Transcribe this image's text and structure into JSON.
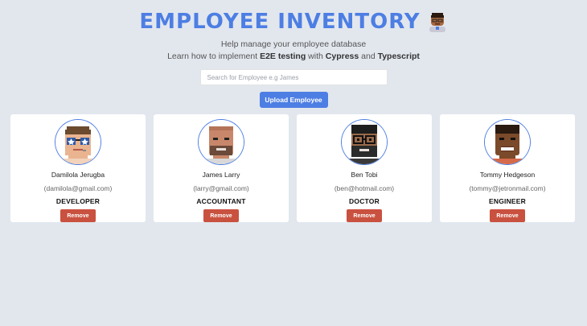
{
  "header": {
    "title": "EMPLOYEE INVENTORY",
    "title_icon": "man-technologist-emoji-icon",
    "subtitle": "Help manage your employee database",
    "tagline": {
      "prefix": "Learn how to implement ",
      "e2e": "E2E testing",
      "with": " with ",
      "cypress": "Cypress",
      "and": " and ",
      "typescript": "Typescript"
    }
  },
  "search": {
    "placeholder": "Search for Employee e.g James",
    "value": ""
  },
  "upload_button": {
    "label": "Upload Employee"
  },
  "colors": {
    "accent": "#4d7ee3",
    "remove": "#c9513f",
    "background": "#e2e7ee"
  },
  "employees": [
    {
      "name": "Damilola Jerugba",
      "email": "(damilola@gmail.com)",
      "role": "DEVELOPER",
      "avatar": "avatar-light-skin-star-glasses-icon",
      "remove_label": "Remove"
    },
    {
      "name": "James Larry",
      "email": "(larry@gmail.com)",
      "role": "ACCOUNTANT",
      "avatar": "avatar-bald-beard-icon",
      "remove_label": "Remove"
    },
    {
      "name": "Ben Tobi",
      "email": "(ben@hotmail.com)",
      "role": "DOCTOR",
      "avatar": "avatar-glasses-beard-icon",
      "remove_label": "Remove"
    },
    {
      "name": "Tommy Hedgeson",
      "email": "(tommy@jetronmail.com)",
      "role": "ENGINEER",
      "avatar": "avatar-smiling-dark-skin-icon",
      "remove_label": "Remove"
    }
  ]
}
